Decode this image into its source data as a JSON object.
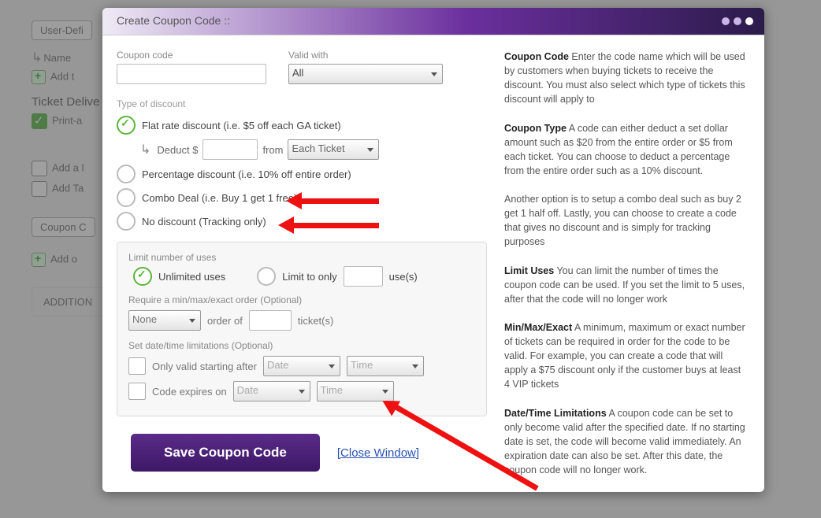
{
  "bg": {
    "userDefined": "User-Defi",
    "name": "Name",
    "addT": "Add t",
    "ticketDelivery": "Ticket Delive",
    "printAt": "Print-a",
    "addl": "Add a l",
    "addTa": "Add Ta",
    "couponC": "Coupon C",
    "addO": "Add o",
    "additional": "ADDITION"
  },
  "modal": {
    "title": "Create Coupon Code ::",
    "couponCodeLabel": "Coupon code",
    "validWithLabel": "Valid with",
    "validWithValue": "All",
    "typeLabel": "Type of discount",
    "flatRate": "Flat rate discount (i.e. $5 off each GA ticket)",
    "deduct": "Deduct $",
    "from": "from",
    "fromValue": "Each Ticket",
    "percent": "Percentage discount (i.e. 10% off entire order)",
    "combo": "Combo Deal (i.e. Buy 1 get 1 free)",
    "noDiscount": "No discount (Tracking only)",
    "limitLabel": "Limit number of uses",
    "unlimited": "Unlimited uses",
    "limitTo": "Limit to only",
    "uses": "use(s)",
    "reqLabel": "Require a min/max/exact order (Optional)",
    "none": "None",
    "orderOf": "order of",
    "tickets": "ticket(s)",
    "dtLabel": "Set date/time limitations (Optional)",
    "validAfter": "Only valid starting after",
    "expires": "Code expires on",
    "date": "Date",
    "time": "Time",
    "save": "Save Coupon Code",
    "close": "[Close Window]"
  },
  "help": {
    "h1": "Coupon Code",
    "p1": "Enter the code name which will be used by customers when buying tickets to receive the discount. You must also select which type of tickets this discount will apply to",
    "h2": "Coupon Type",
    "p2": "A code can either deduct a set dollar amount such as $20 from the entire order or $5 from each ticket. You can choose to deduct a percentage from the entire order such as a 10% discount.",
    "p2b": "Another option is to setup a combo deal such as buy 2 get 1 half off. Lastly, you can choose to create a code that gives no discount and is simply for tracking purposes",
    "h3": "Limit Uses",
    "p3": "You can limit the number of times the coupon code can be used. If you set the limit to 5 uses, after that the code will no longer work",
    "h4": "Min/Max/Exact",
    "p4": "A minimum, maximum or exact number of tickets can be required in order for the code to be valid. For example, you can create a code that will apply a $75 discount only if the customer buys at least 4 VIP tickets",
    "h5": "Date/Time Limitations",
    "p5": "A coupon code can be set to only become valid after the specified date. If no starting date is set, the code will become valid immediately. An expiration date can also be set. After this date, the coupon code will no longer work."
  }
}
